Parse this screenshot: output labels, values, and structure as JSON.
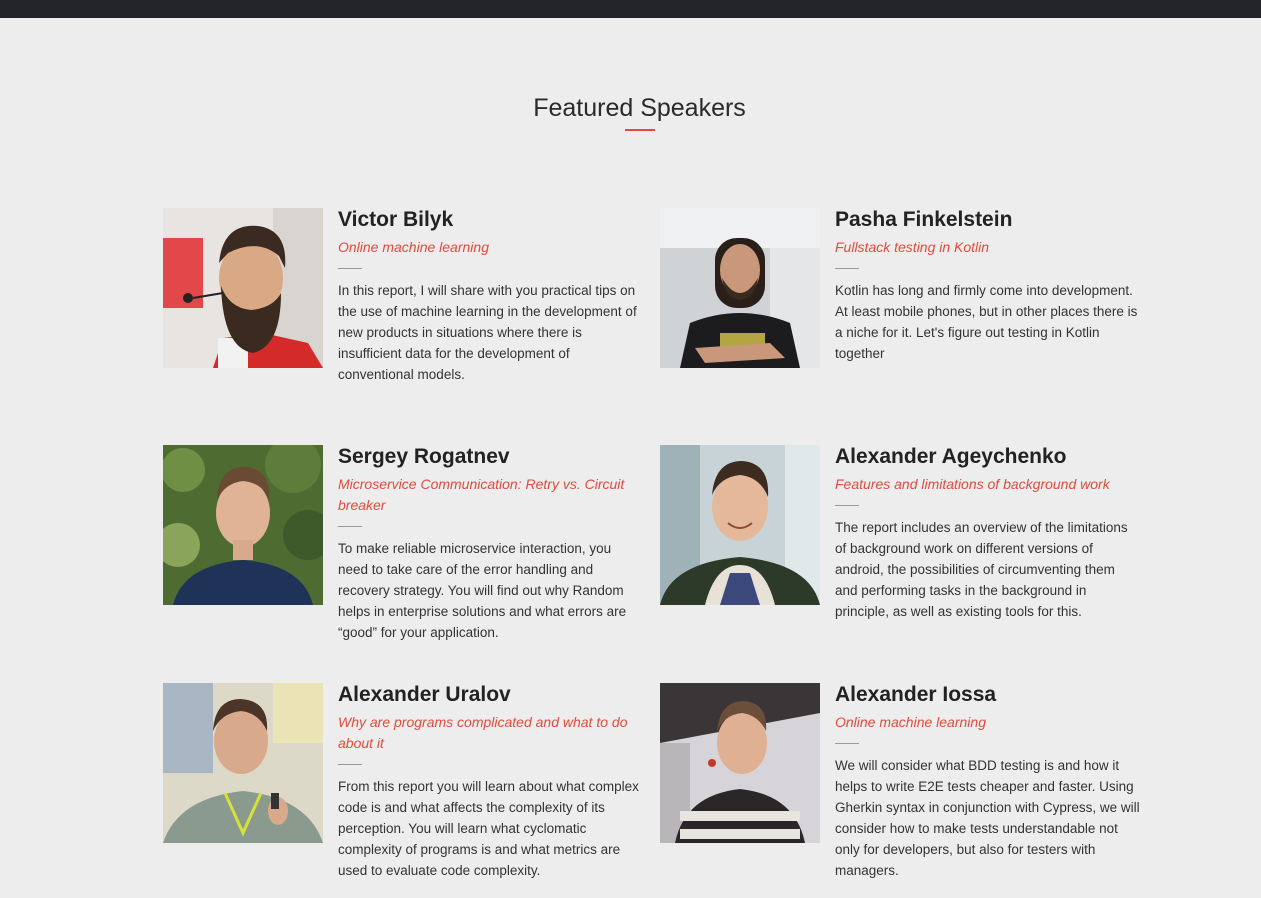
{
  "section": {
    "title": "Featured Speakers"
  },
  "colors": {
    "accent": "#e04b3c",
    "background": "#ededed",
    "top_bar": "#23252b"
  },
  "speakers": [
    {
      "name": "Victor Bilyk",
      "topic": "Online machine learning",
      "description": "In this report, I will share with you practical tips on the use of machine learning in the development of new products in situations where there is insufficient data for the development of conventional models.",
      "photo": "speaker-photo"
    },
    {
      "name": "Pasha Finkelstein",
      "topic": "Fullstack testing in Kotlin",
      "description": "Kotlin has long and firmly come into development. At least mobile phones, but in other places there is a niche for it. Let's figure out testing in Kotlin together",
      "photo": "speaker-photo"
    },
    {
      "name": "Sergey Rogatnev",
      "topic": "Microservice Communication: Retry vs. Circuit breaker",
      "description": "To make reliable microservice interaction, you need to take care of the error handling and recovery strategy. You will find out why Random helps in enterprise solutions and what errors are “good” for your application.",
      "photo": "speaker-photo"
    },
    {
      "name": "Alexander Ageychenko",
      "topic": "Features and limitations of background work",
      "description": "The report includes an overview of the limitations of background work on different versions of android, the possibilities of circumventing them and performing tasks in the background in principle, as well as existing tools for this.",
      "photo": "speaker-photo"
    },
    {
      "name": "Alexander Uralov",
      "topic": "Why are programs complicated and what to do about it",
      "description": "From this report you will learn about what complex code is and what affects the complexity of its perception. You will learn what cyclomatic complexity of programs is and what metrics are used to evaluate code complexity.",
      "photo": "speaker-photo"
    },
    {
      "name": "Alexander Iossa",
      "topic": "Online machine learning",
      "description": "We will consider what BDD testing is and how it helps to write E2E tests cheaper and faster. Using Gherkin syntax in conjunction with Cypress, we will consider how to make tests understandable not only for developers, but also for testers with managers.",
      "photo": "speaker-photo"
    }
  ]
}
